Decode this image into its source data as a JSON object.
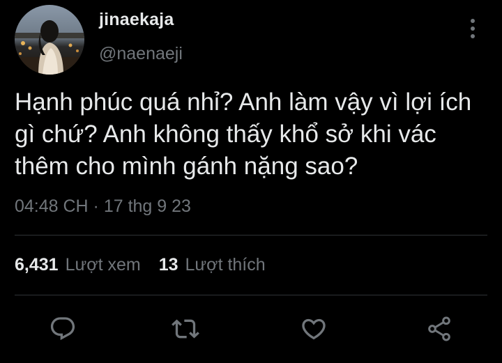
{
  "user": {
    "display_name": "jinaekaja",
    "handle": "@naenaeji",
    "avatar_icon": "profile-photo"
  },
  "tweet": {
    "text": "Hạnh phúc quá nhỉ? Anh làm vậy vì lợi ích\ngì chứ? Anh không thấy khổ sở khi vác\nthêm cho mình gánh nặng sao?",
    "timestamp": "04:48 CH · 17 thg 9 23"
  },
  "stats": {
    "views_count": "6,431",
    "views_label": "Lượt xem",
    "likes_count": "13",
    "likes_label": "Lượt thích"
  },
  "actions": {
    "reply_icon": "reply-icon",
    "retweet_icon": "retweet-icon",
    "like_icon": "heart-icon",
    "share_icon": "share-icon"
  },
  "colors": {
    "background": "#000000",
    "primary_text": "#e7e9ea",
    "secondary_text": "#71767b",
    "divider": "#2f3336"
  }
}
